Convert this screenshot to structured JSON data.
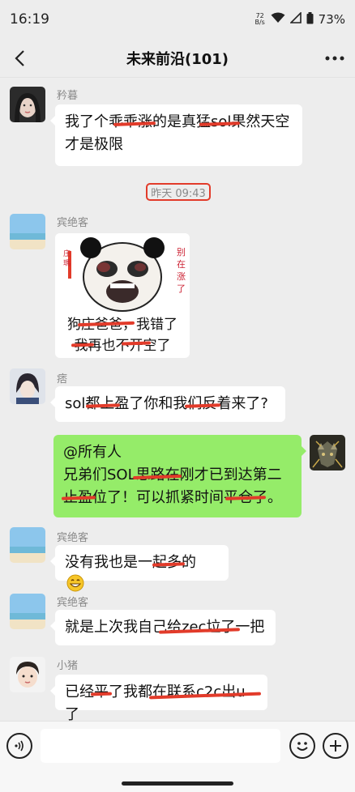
{
  "status_bar": {
    "time": "16:19",
    "net_rate_top": "72",
    "net_rate_bottom": "B/s",
    "battery": "73%"
  },
  "nav": {
    "title": "未来前沿(101)"
  },
  "divider": {
    "time": "昨天 09:43"
  },
  "messages": [
    {
      "sender": "矜暮",
      "text_line1": "我了个乖乖涨的是真猛sol果然天空",
      "text_line2": "才是极限"
    },
    {
      "sender": "宾绝客",
      "sticker_caption_line1": "狗庄爸爸，我错了",
      "sticker_caption_line2": "我再也不开空了",
      "sticker_side_text": "别在涨了"
    },
    {
      "sender": "痞",
      "text": "sol都上盈了你和我们反着来了?"
    },
    {
      "self": true,
      "text_line1": "@所有人",
      "text_line2": "兄弟们SOL思路在刚才已到达第二",
      "text_line3": "止盈位了！可以抓紧时间平仓了。"
    },
    {
      "sender": "宾绝客",
      "text": "没有我也是一起多的"
    },
    {
      "sender": "宾绝客",
      "text": "就是上次我自己给zec垃了一把"
    },
    {
      "sender": "小猪",
      "text": "已经平了我都在联系c2c出u了"
    }
  ],
  "colors": {
    "background": "#ededed",
    "self_bubble": "#95ec69",
    "annotation_red": "#e23b2a"
  }
}
